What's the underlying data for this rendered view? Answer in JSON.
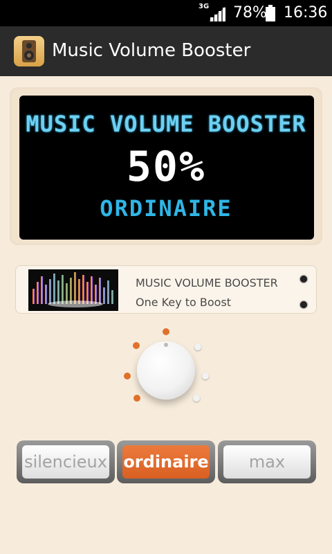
{
  "status_bar": {
    "network": "3G",
    "battery_percent": "78%",
    "time": "16:36"
  },
  "app_bar": {
    "title": "Music Volume Booster",
    "icon": "speaker-icon"
  },
  "display": {
    "title": "MUSIC VOLUME BOOSTER",
    "percent": "50%",
    "mode": "ORDINAIRE"
  },
  "card": {
    "title": "MUSIC VOLUME BOOSTER",
    "subtitle": "One Key to Boost"
  },
  "knob": {
    "level_percent": 50
  },
  "buttons": [
    {
      "label": "silencieux"
    },
    {
      "label": "ordinaire"
    },
    {
      "label": "max"
    }
  ],
  "colors": {
    "accent": "#e0712b",
    "lcd": "#2fb6e6",
    "background": "#f7ecdc"
  }
}
